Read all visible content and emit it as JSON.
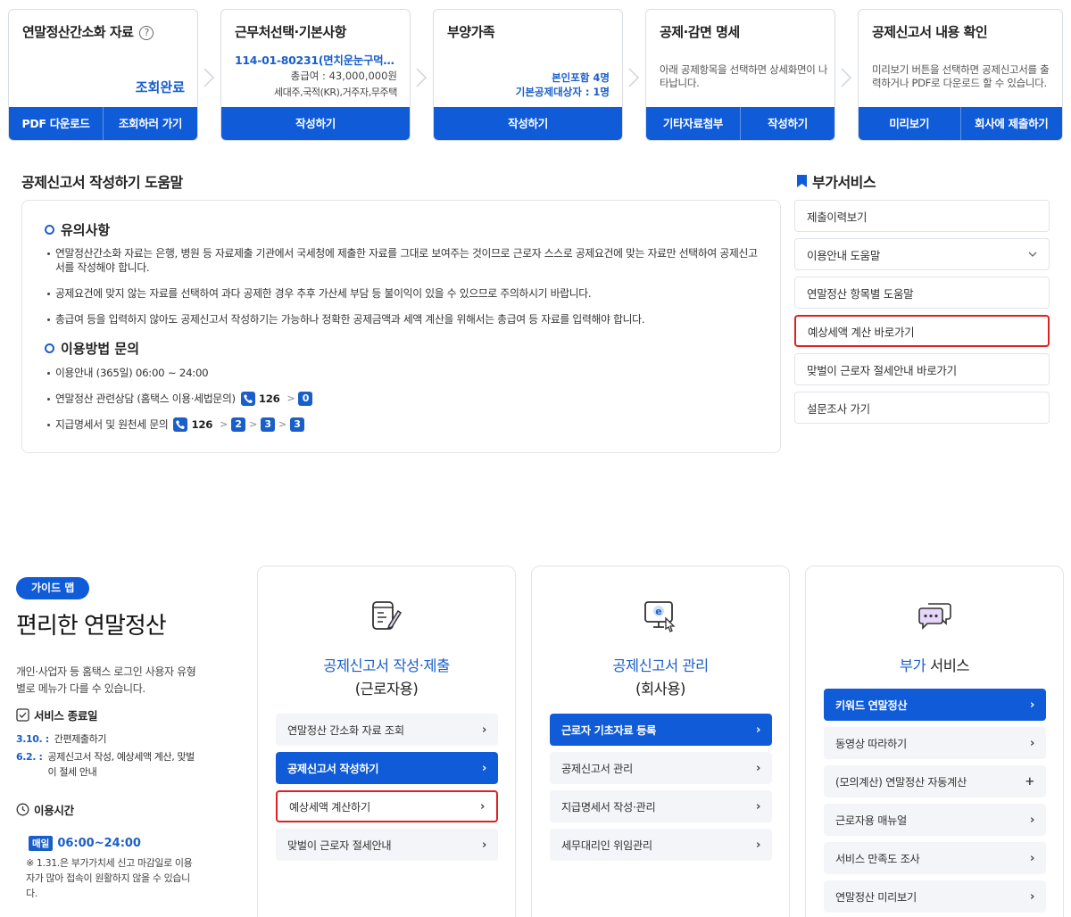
{
  "steps": [
    {
      "title": "연말정산간소화 자료",
      "status": "조회완료",
      "buttons": [
        "PDF 다운로드",
        "조회하러 가기"
      ]
    },
    {
      "title": "근무처선택·기본사항",
      "biz": "114-01-80231(면치운눈구먹…",
      "salary": "총급여 : 43,000,000원",
      "household": "세대주,국적(KR),거주자,무주택",
      "buttons": [
        "작성하기"
      ]
    },
    {
      "title": "부양가족",
      "dep_self": "본인포함 4명",
      "dep_basic": "기본공제대상자 : 1명",
      "buttons": [
        "작성하기"
      ]
    },
    {
      "title": "공제·감면 명세",
      "desc": "아래 공제항목을 선택하면 상세화면이 나타납니다.",
      "buttons": [
        "기타자료첨부",
        "작성하기"
      ]
    },
    {
      "title": "공제신고서 내용 확인",
      "desc": "미리보기 버튼을 선택하면 공제신고서를 출력하거나 PDF로 다운로드 할 수 있습니다.",
      "buttons": [
        "미리보기",
        "회사에 제출하기"
      ]
    }
  ],
  "help": {
    "title": "공제신고서 작성하기 도움말",
    "notice_title": "유의사항",
    "notices": [
      "연말정산간소화 자료는 은행, 병원 등 자료제출 기관에서 국세청에 제출한 자료를 그대로 보여주는 것이므로 근로자 스스로 공제요건에 맞는 자료만 선택하여 공제신고서를 작성해야 합니다.",
      "공제요건에 맞지 않는 자료를 선택하여 과다 공제한 경우 추후 가산세 부담 등 불이익이 있을 수 있으므로 주의하시기 바랍니다.",
      "총급여 등을 입력하지 않아도 공제신고서 작성하기는 가능하나 정확한 공제금액과 세액 계산을 위해서는 총급여 등 자료를 입력해야 합니다."
    ],
    "contact_title": "이용방법 문의",
    "hours_line": "이용안내 (365일) 06:00 ~ 24:00",
    "contact1_label": "연말정산 관련상담 (홈택스 이용·세법문의)",
    "contact1_number": "126",
    "contact1_keys": [
      "0"
    ],
    "contact2_label": "지급명세서 및 원천세 문의",
    "contact2_number": "126",
    "contact2_keys": [
      "2",
      "3",
      "3"
    ]
  },
  "side": {
    "title": "부가서비스",
    "items": [
      "제출이력보기",
      "이용안내 도움말",
      "연말정산 항목별 도움말",
      "예상세액 계산 바로가기",
      "맞벌이 근로자 절세안내 바로가기",
      "설문조사 가기"
    ]
  },
  "guide": {
    "badge": "가이드 맵",
    "title": "편리한 연말정산",
    "desc": "개인·사업자 등 홈택스 로그인 사용자 유형별로 메뉴가 다를 수 있습니다.",
    "end_title": "서비스 종료일",
    "end_items": [
      {
        "date": "3.10. :",
        "text": "간편제출하기"
      },
      {
        "date": "6.2. :",
        "text": "공제신고서 작성, 예상세액 계산, 맞벌이 절세 안내"
      }
    ],
    "hours_title": "이용시간",
    "daily": "매일",
    "hours": "06:00~24:00",
    "hours_note": "※ 1.31.은 부가가치세 신고 마감일로 이용자가 많아 접속이 원활하지 않을 수 있습니다."
  },
  "cards": [
    {
      "title": "공제신고서 작성·제출",
      "sub": "(근로자용)",
      "items": [
        "연말정산 간소화 자료 조회",
        "공제신고서 작성하기",
        "예상세액 계산하기",
        "맞벌이 근로자 절세안내"
      ]
    },
    {
      "title": "공제신고서 관리",
      "sub": "(회사용)",
      "items": [
        "근로자 기초자료 등록",
        "공제신고서 관리",
        "지급명세서 작성·관리",
        "세무대리인 위임관리"
      ]
    },
    {
      "title_blue": "부가",
      "title_dark": " 서비스",
      "items": [
        "키워드 연말정산",
        "동영상 따라하기",
        "(모의계산) 연말정산 자동계산",
        "근로자용 매뉴얼",
        "서비스 만족도 조사",
        "연말정산 미리보기"
      ]
    }
  ],
  "colors": {
    "primary": "#0f5bd8",
    "accent_text": "#1a5fc9",
    "highlight": "#e02020"
  },
  "icons": {
    "help": "question-circle-icon",
    "step_arrow": "chevron-right-icon",
    "phone": "phone-icon",
    "bookmark": "bookmark-icon",
    "expand": "chevron-down-icon",
    "checklist": "checkbox-icon",
    "clock": "clock-icon",
    "document": "document-edit-icon",
    "monitor": "monitor-e-icon",
    "chat": "chat-bubble-icon"
  }
}
